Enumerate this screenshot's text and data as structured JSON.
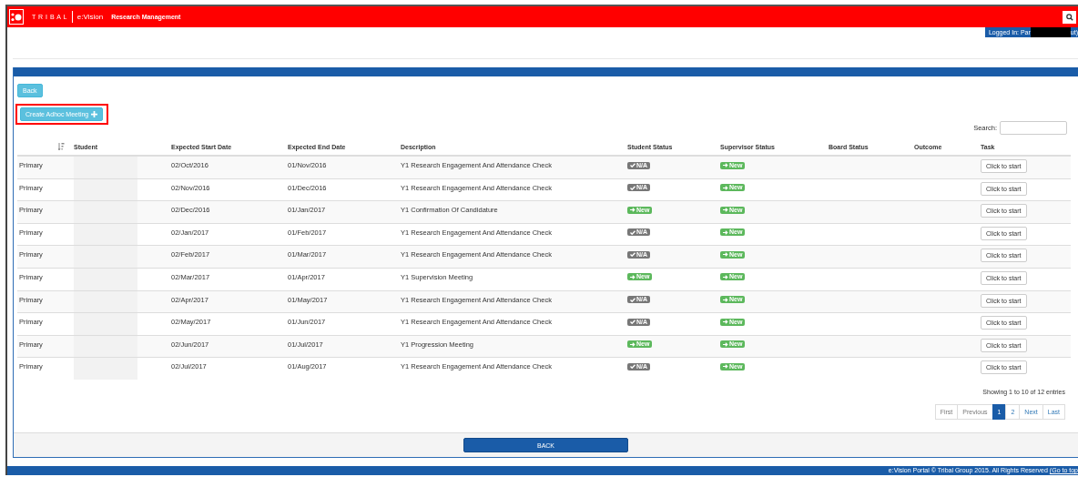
{
  "header": {
    "brand": "T R I B A L",
    "product": "e:Vision",
    "title": "Research Management"
  },
  "user_bar": {
    "label": "Logged In: Par",
    "tail": "ut)"
  },
  "buttons": {
    "back": "Back",
    "create": "Create Adhoc Meeting"
  },
  "search": {
    "label": "Search:"
  },
  "table": {
    "columns": [
      "Student",
      "Expected Start Date",
      "Expected End Date",
      "Description",
      "Student Status",
      "Supervisor Status",
      "Board Status",
      "Outcome",
      "Task"
    ],
    "rows": [
      {
        "type": "Primary",
        "start": "02/Oct/2016",
        "end": "01/Nov/2016",
        "description": "Y1 Research Engagement And Attendance Check",
        "student_status": {
          "kind": "na",
          "label": "N/A"
        },
        "supervisor_status": {
          "kind": "new",
          "label": "New"
        },
        "task": "Click to start"
      },
      {
        "type": "Primary",
        "start": "02/Nov/2016",
        "end": "01/Dec/2016",
        "description": "Y1 Research Engagement And Attendance Check",
        "student_status": {
          "kind": "na",
          "label": "N/A"
        },
        "supervisor_status": {
          "kind": "new",
          "label": "New"
        },
        "task": "Click to start"
      },
      {
        "type": "Primary",
        "start": "02/Dec/2016",
        "end": "01/Jan/2017",
        "description": "Y1 Confirmation Of Candidature",
        "student_status": {
          "kind": "new",
          "label": "New"
        },
        "supervisor_status": {
          "kind": "new",
          "label": "New"
        },
        "task": "Click to start"
      },
      {
        "type": "Primary",
        "start": "02/Jan/2017",
        "end": "01/Feb/2017",
        "description": "Y1 Research Engagement And Attendance Check",
        "student_status": {
          "kind": "na",
          "label": "N/A"
        },
        "supervisor_status": {
          "kind": "new",
          "label": "New"
        },
        "task": "Click to start"
      },
      {
        "type": "Primary",
        "start": "02/Feb/2017",
        "end": "01/Mar/2017",
        "description": "Y1 Research Engagement And Attendance Check",
        "student_status": {
          "kind": "na",
          "label": "N/A"
        },
        "supervisor_status": {
          "kind": "new",
          "label": "New"
        },
        "task": "Click to start"
      },
      {
        "type": "Primary",
        "start": "02/Mar/2017",
        "end": "01/Apr/2017",
        "description": "Y1 Supervision Meeting",
        "student_status": {
          "kind": "new",
          "label": "New"
        },
        "supervisor_status": {
          "kind": "new",
          "label": "New"
        },
        "task": "Click to start"
      },
      {
        "type": "Primary",
        "start": "02/Apr/2017",
        "end": "01/May/2017",
        "description": "Y1 Research Engagement And Attendance Check",
        "student_status": {
          "kind": "na",
          "label": "N/A"
        },
        "supervisor_status": {
          "kind": "new",
          "label": "New"
        },
        "task": "Click to start"
      },
      {
        "type": "Primary",
        "start": "02/May/2017",
        "end": "01/Jun/2017",
        "description": "Y1 Research Engagement And Attendance Check",
        "student_status": {
          "kind": "na",
          "label": "N/A"
        },
        "supervisor_status": {
          "kind": "new",
          "label": "New"
        },
        "task": "Click to start"
      },
      {
        "type": "Primary",
        "start": "02/Jun/2017",
        "end": "01/Jul/2017",
        "description": "Y1 Progression Meeting",
        "student_status": {
          "kind": "new",
          "label": "New"
        },
        "supervisor_status": {
          "kind": "new",
          "label": "New"
        },
        "task": "Click to start"
      },
      {
        "type": "Primary",
        "start": "02/Jul/2017",
        "end": "01/Aug/2017",
        "description": "Y1 Research Engagement And Attendance Check",
        "student_status": {
          "kind": "na",
          "label": "N/A"
        },
        "supervisor_status": {
          "kind": "new",
          "label": "New"
        },
        "task": "Click to start"
      }
    ]
  },
  "info": "Showing 1 to 10 of 12 entries",
  "pagination": [
    {
      "label": "First",
      "selected": false
    },
    {
      "label": "Previous",
      "selected": false
    },
    {
      "label": "1",
      "selected": true
    },
    {
      "label": "2",
      "selected": false
    },
    {
      "label": "Next",
      "selected": false
    },
    {
      "label": "Last",
      "selected": false
    }
  ],
  "back_bottom": "BACK",
  "footer": {
    "text": "e:Vision Portal © Tribal Group 2015. All Rights Reserved",
    "link": "(Go to top"
  }
}
